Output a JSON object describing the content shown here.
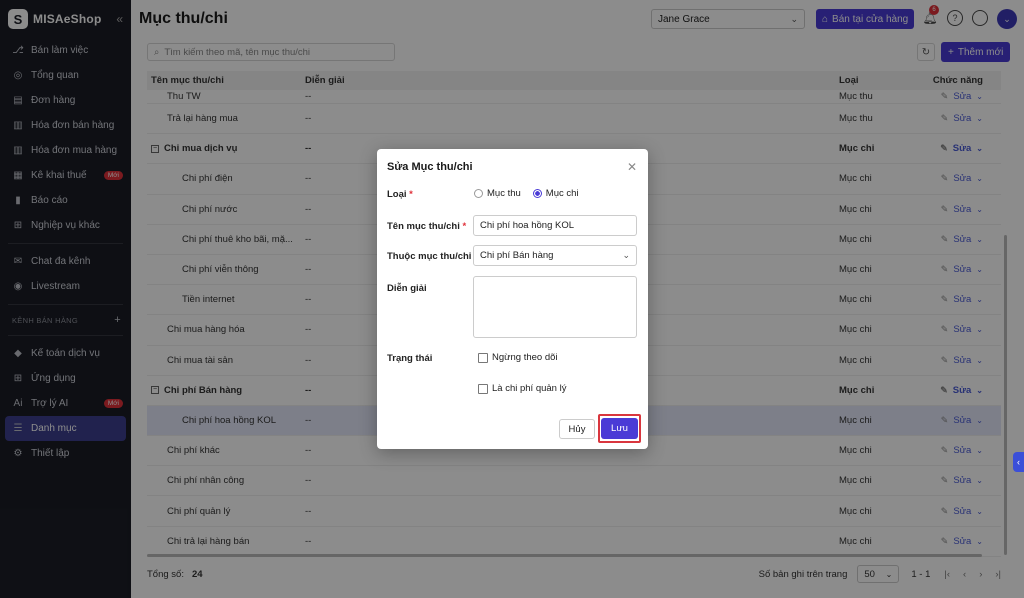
{
  "sidebar": {
    "logo_text": "MISAeShop",
    "collapse_icon": "«",
    "items": [
      {
        "label": "Bán làm việc",
        "icon": "⎇"
      },
      {
        "label": "Tổng quan",
        "icon": "◎"
      },
      {
        "label": "Đơn hàng",
        "icon": "▤"
      },
      {
        "label": "Hóa đơn bán hàng",
        "icon": "▥"
      },
      {
        "label": "Hóa đơn mua hàng",
        "icon": "▥"
      },
      {
        "label": "Kê khai thuế",
        "icon": "▦",
        "badge": "Mới"
      },
      {
        "label": "Báo cáo",
        "icon": "▮"
      },
      {
        "label": "Nghiệp vụ khác",
        "icon": "⊞"
      },
      {
        "label": "Chat đa kênh",
        "icon": "✉"
      },
      {
        "label": "Livestream",
        "icon": "◉"
      }
    ],
    "section_label": "KÊNH BÁN HÀNG",
    "section_plus": "+",
    "items2": [
      {
        "label": "Kế toán dịch vụ",
        "icon": "◆"
      },
      {
        "label": "Ứng dụng",
        "icon": "⊞"
      },
      {
        "label": "Trợ lý AI",
        "icon": "Ai",
        "badge": "Mới"
      },
      {
        "label": "Danh mục",
        "icon": "☰"
      },
      {
        "label": "Thiết lập",
        "icon": "⚙"
      }
    ]
  },
  "header": {
    "title": "Mục thu/chi",
    "store_select": "Jane Grace",
    "sell_button": "Bán tại cửa hàng",
    "notification_count": "6"
  },
  "toolbar": {
    "search_placeholder": "Tìm kiếm theo mã, tên mục thu/chi",
    "add_button": "Thêm mới"
  },
  "table": {
    "headers": {
      "name": "Tên mục thu/chi",
      "desc": "Diễn giải",
      "type": "Loại",
      "actions": "Chức năng"
    },
    "edit_label": "Sửa",
    "rows": [
      {
        "name": "Thu TW",
        "desc": "--",
        "type": "Mục thu",
        "level": 1
      },
      {
        "name": "Trả lại hàng mua",
        "desc": "--",
        "type": "Mục thu",
        "level": 1
      },
      {
        "name": "Chi mua dịch vụ",
        "desc": "--",
        "type": "Mục chi",
        "level": 0,
        "group": true
      },
      {
        "name": "Chi phí điện",
        "desc": "--",
        "type": "Mục chi",
        "level": 2
      },
      {
        "name": "Chi phí nước",
        "desc": "--",
        "type": "Mục chi",
        "level": 2
      },
      {
        "name": "Chi phí thuê kho bãi, mặ...",
        "desc": "--",
        "type": "Mục chi",
        "level": 2
      },
      {
        "name": "Chi phí viễn thông",
        "desc": "--",
        "type": "Mục chi",
        "level": 2
      },
      {
        "name": "Tiền internet",
        "desc": "--",
        "type": "Mục chi",
        "level": 2
      },
      {
        "name": "Chi mua hàng hóa",
        "desc": "--",
        "type": "Mục chi",
        "level": 1
      },
      {
        "name": "Chi mua tài sản",
        "desc": "--",
        "type": "Mục chi",
        "level": 1
      },
      {
        "name": "Chi phí Bán hàng",
        "desc": "--",
        "type": "Mục chi",
        "level": 0,
        "group": true
      },
      {
        "name": "Chi phí hoa hồng KOL",
        "desc": "--",
        "type": "Mục chi",
        "level": 2,
        "highlight": true
      },
      {
        "name": "Chi phí khác",
        "desc": "--",
        "type": "Mục chi",
        "level": 1
      },
      {
        "name": "Chi phí nhân công",
        "desc": "--",
        "type": "Mục chi",
        "level": 1
      },
      {
        "name": "Chi phí quản lý",
        "desc": "--",
        "type": "Mục chi",
        "level": 1
      },
      {
        "name": "Chi trả lại hàng bán",
        "desc": "--",
        "type": "Mục chi",
        "level": 1
      }
    ]
  },
  "footer": {
    "total_label": "Tổng số:",
    "total_value": "24",
    "per_page_label": "Số bản ghi trên trang",
    "per_page_value": "50",
    "range": "1 - 1"
  },
  "modal": {
    "title": "Sửa Mục thu/chi",
    "type_label": "Loại",
    "type_options": [
      "Mục thu",
      "Mục chi"
    ],
    "type_selected": "Mục chi",
    "name_label": "Tên mục thu/chi",
    "name_value": "Chi phí hoa hồng KOL",
    "parent_label": "Thuộc mục thu/chi",
    "parent_value": "Chi phí Bán hàng",
    "desc_label": "Diễn giải",
    "desc_value": "",
    "status_label": "Trạng thái",
    "check_stop": "Ngừng theo dõi",
    "check_mgmt": "Là chi phí quản lý",
    "cancel_button": "Hủy",
    "save_button": "Lưu"
  }
}
